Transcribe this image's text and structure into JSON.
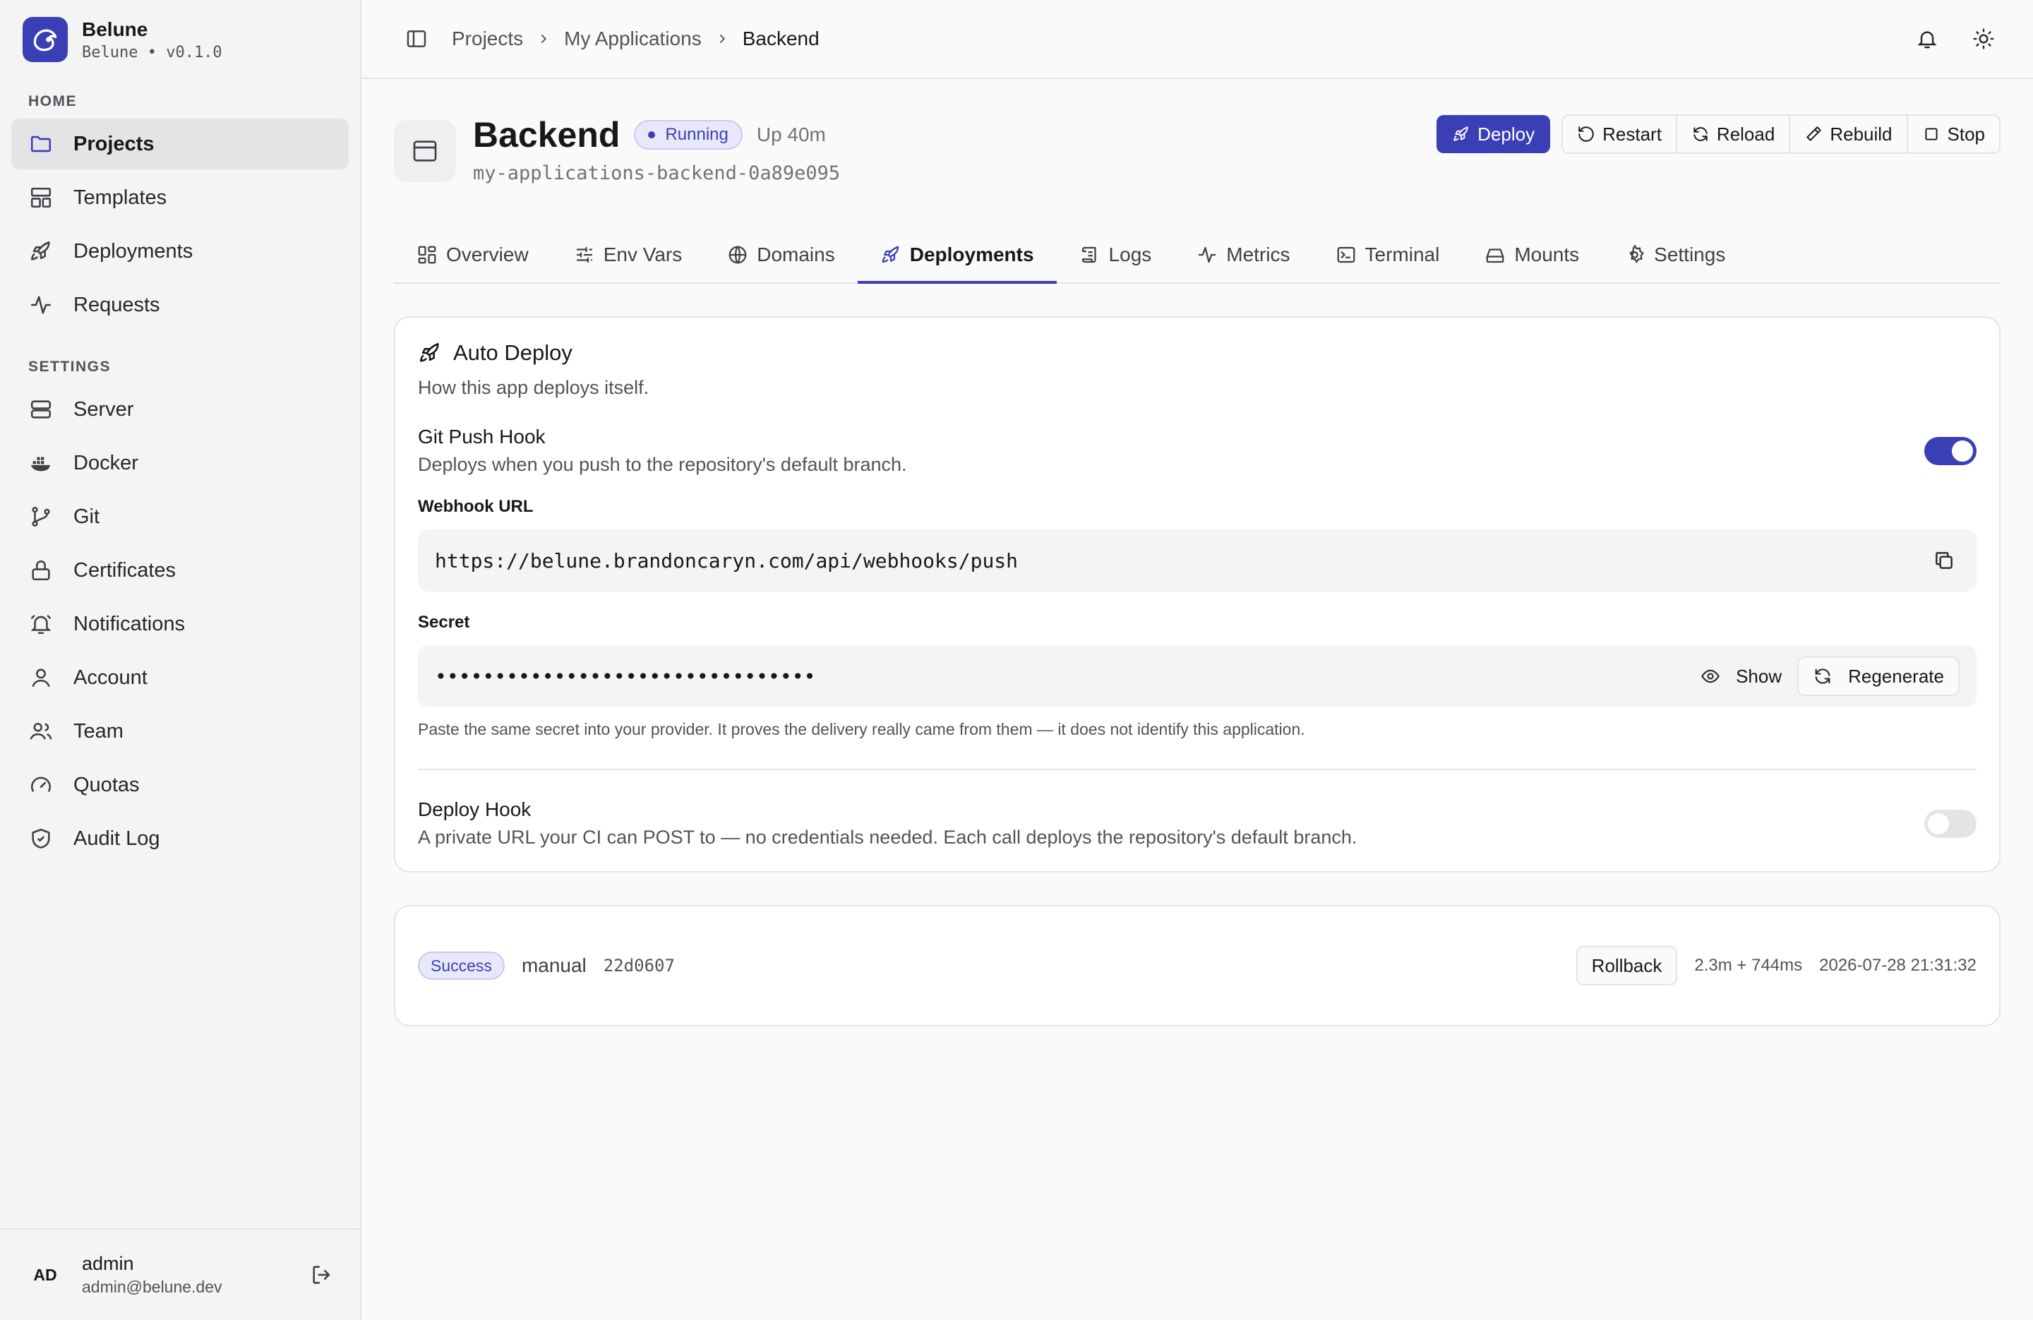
{
  "brand": {
    "name": "Belune",
    "subtitle": "Belune • v0.1.0"
  },
  "sidebar": {
    "home_label": "HOME",
    "home_items": [
      {
        "label": "Projects",
        "icon": "folder-icon",
        "active": true
      },
      {
        "label": "Templates",
        "icon": "layout-icon"
      },
      {
        "label": "Deployments",
        "icon": "rocket-icon"
      },
      {
        "label": "Requests",
        "icon": "activity-icon"
      }
    ],
    "settings_label": "SETTINGS",
    "settings_items": [
      {
        "label": "Server",
        "icon": "server-icon"
      },
      {
        "label": "Docker",
        "icon": "docker-icon"
      },
      {
        "label": "Git",
        "icon": "git-branch-icon"
      },
      {
        "label": "Certificates",
        "icon": "lock-icon"
      },
      {
        "label": "Notifications",
        "icon": "bell-icon"
      },
      {
        "label": "Account",
        "icon": "user-icon"
      },
      {
        "label": "Team",
        "icon": "users-icon"
      },
      {
        "label": "Quotas",
        "icon": "gauge-icon"
      },
      {
        "label": "Audit Log",
        "icon": "shield-icon"
      }
    ]
  },
  "user": {
    "initials": "AD",
    "name": "admin",
    "email": "admin@belune.dev"
  },
  "breadcrumb": [
    "Projects",
    "My Applications",
    "Backend"
  ],
  "app": {
    "title": "Backend",
    "status": "Running",
    "uptime": "Up 40m",
    "slug": "my-applications-backend-0a89e095"
  },
  "actions": {
    "deploy": "Deploy",
    "restart": "Restart",
    "reload": "Reload",
    "rebuild": "Rebuild",
    "stop": "Stop"
  },
  "tabs": [
    {
      "label": "Overview",
      "icon": "grid-icon"
    },
    {
      "label": "Env Vars",
      "icon": "sliders-icon"
    },
    {
      "label": "Domains",
      "icon": "globe-icon"
    },
    {
      "label": "Deployments",
      "icon": "rocket-icon",
      "active": true
    },
    {
      "label": "Logs",
      "icon": "scroll-icon"
    },
    {
      "label": "Metrics",
      "icon": "activity-icon"
    },
    {
      "label": "Terminal",
      "icon": "terminal-icon"
    },
    {
      "label": "Mounts",
      "icon": "hard-drive-icon"
    },
    {
      "label": "Settings",
      "icon": "gear-icon"
    }
  ],
  "auto_deploy": {
    "title": "Auto Deploy",
    "description": "How this app deploys itself.",
    "git_push": {
      "title": "Git Push Hook",
      "description": "Deploys when you push to the repository's default branch.",
      "enabled": true
    },
    "webhook_label": "Webhook URL",
    "webhook_url": "https://belune.brandoncaryn.com/api/webhooks/push",
    "secret_label": "Secret",
    "secret_value": "••••••••••••••••••••••••••••••••",
    "show_label": "Show",
    "regenerate_label": "Regenerate",
    "secret_hint": "Paste the same secret into your provider. It proves the delivery really came from them — it does not identify this application.",
    "deploy_hook": {
      "title": "Deploy Hook",
      "description": "A private URL your CI can POST to — no credentials needed. Each call deploys the repository's default branch.",
      "enabled": false
    }
  },
  "deployment": {
    "status": "Success",
    "trigger": "manual",
    "commit": "22d0607",
    "rollback_label": "Rollback",
    "duration": "2.3m + 744ms",
    "timestamp": "2026-07-28 21:31:32"
  },
  "colors": {
    "accent": "#3b3fb6",
    "border": "#e4e4e7",
    "sidebar_bg": "#f4f4f5"
  }
}
